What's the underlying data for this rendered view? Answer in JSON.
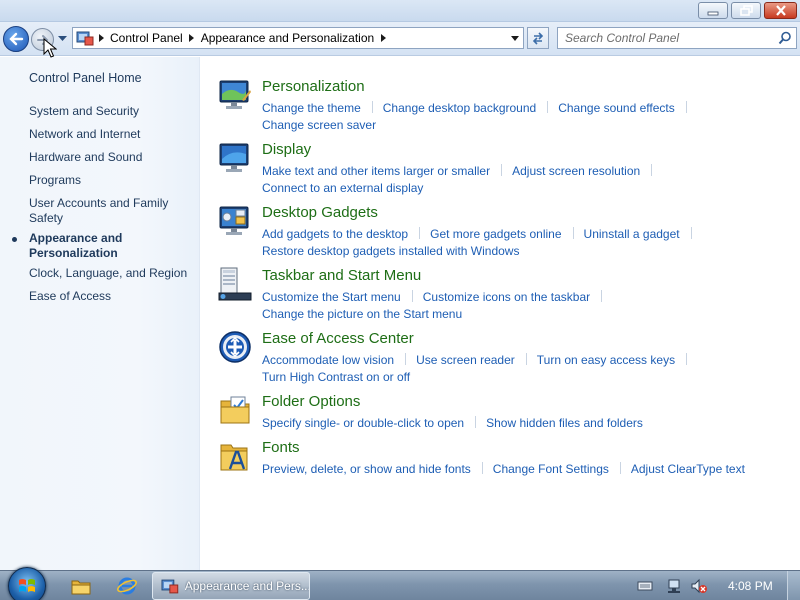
{
  "address_bar": {
    "crumbs": [
      "Control Panel",
      "Appearance and Personalization"
    ]
  },
  "search": {
    "placeholder": "Search Control Panel"
  },
  "left_pane": {
    "home_label": "Control Panel Home",
    "items": [
      {
        "label": "System and Security"
      },
      {
        "label": "Network and Internet"
      },
      {
        "label": "Hardware and Sound"
      },
      {
        "label": "Programs"
      },
      {
        "label": "User Accounts and Family Safety"
      },
      {
        "label": "Appearance and Personalization",
        "current": true
      },
      {
        "label": "Clock, Language, and Region"
      },
      {
        "label": "Ease of Access"
      }
    ]
  },
  "categories": [
    {
      "title": "Personalization",
      "icon": "personalization-icon",
      "links": [
        "Change the theme",
        "Change desktop background",
        "Change sound effects",
        "Change screen saver"
      ]
    },
    {
      "title": "Display",
      "icon": "display-icon",
      "links": [
        "Make text and other items larger or smaller",
        "Adjust screen resolution",
        "Connect to an external display"
      ]
    },
    {
      "title": "Desktop Gadgets",
      "icon": "desktop-gadgets-icon",
      "links": [
        "Add gadgets to the desktop",
        "Get more gadgets online",
        "Uninstall a gadget",
        "Restore desktop gadgets installed with Windows"
      ]
    },
    {
      "title": "Taskbar and Start Menu",
      "icon": "taskbar-icon",
      "links": [
        "Customize the Start menu",
        "Customize icons on the taskbar",
        "Change the picture on the Start menu"
      ]
    },
    {
      "title": "Ease of Access Center",
      "icon": "ease-of-access-icon",
      "links": [
        "Accommodate low vision",
        "Use screen reader",
        "Turn on easy access keys",
        "Turn High Contrast on or off"
      ]
    },
    {
      "title": "Folder Options",
      "icon": "folder-options-icon",
      "links": [
        "Specify single- or double-click to open",
        "Show hidden files and folders"
      ]
    },
    {
      "title": "Fonts",
      "icon": "fonts-icon",
      "links": [
        "Preview, delete, or show and hide fonts",
        "Change Font Settings",
        "Adjust ClearType text"
      ]
    }
  ],
  "taskbar": {
    "active_task_label": "Appearance and Pers...",
    "clock": "4:08 PM"
  },
  "colors": {
    "category_title": "#1e6e16",
    "link": "#1e5eb4",
    "left_nav_text": "#1e395b"
  }
}
